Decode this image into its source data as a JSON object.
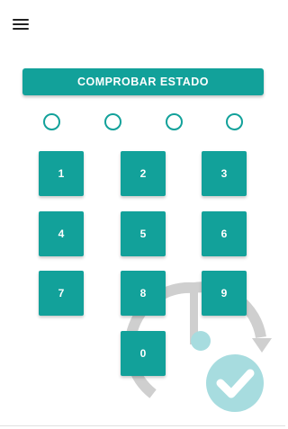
{
  "toolbar": {
    "menu_icon": "hamburger-menu-icon"
  },
  "check_button": {
    "label": "COMPROBAR ESTADO"
  },
  "pin_indicators": {
    "count": 4,
    "filled": 0
  },
  "keypad": {
    "keys": [
      "1",
      "2",
      "3",
      "4",
      "5",
      "6",
      "7",
      "8",
      "9",
      "0"
    ]
  },
  "illustration": {
    "icon": "sync-check-icon"
  },
  "colors": {
    "accent": "#12a19a",
    "illustration_gray": "#cfcfcf",
    "illustration_teal": "#a7dcdf",
    "background": "#ffffff"
  }
}
